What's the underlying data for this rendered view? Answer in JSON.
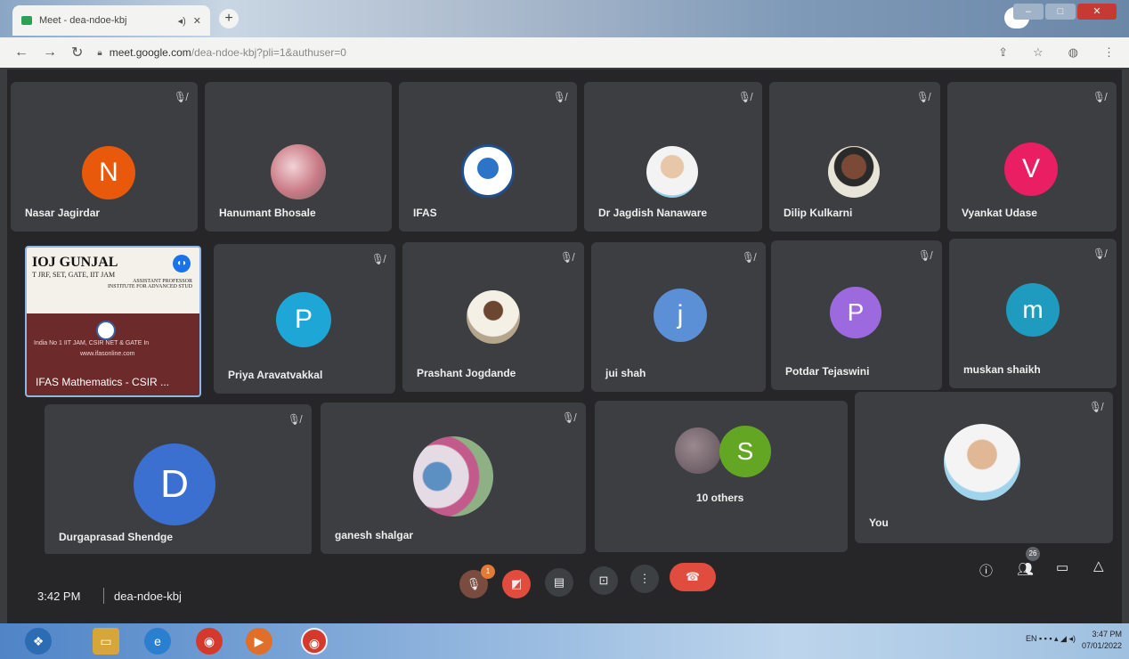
{
  "browser": {
    "tab_title": "Meet - dea-ndoe-kbj",
    "new_tab": "+",
    "url_host": "meet.google.com",
    "url_path": "/dea-ndoe-kbj?pli=1&authuser=0"
  },
  "meeting": {
    "time": "3:42 PM",
    "code": "dea-ndoe-kbj",
    "participant_count": "26",
    "raised_hands": "1"
  },
  "tiles": [
    {
      "name": "Nasar Jagirdar",
      "initial": "N",
      "color": "#e8590c"
    },
    {
      "name": "Hanumant Bhosale",
      "initial": "",
      "color": "#d9a0a5"
    },
    {
      "name": "IFAS",
      "initial": "",
      "color": "#ffffff"
    },
    {
      "name": "Dr Jagdish Nanaware",
      "initial": "",
      "color": "#9ad3e6"
    },
    {
      "name": "Dilip Kulkarni",
      "initial": "",
      "color": "#e6e1d5"
    },
    {
      "name": "Vyankat Udase",
      "initial": "V",
      "color": "#e91e63"
    },
    {
      "name": "Priya Aravatvakkal",
      "initial": "P",
      "color": "#1ea7d6"
    },
    {
      "name": "Prashant Jogdande",
      "initial": "",
      "color": "#c7b89c"
    },
    {
      "name": "jui shah",
      "initial": "j",
      "color": "#5b8fd6"
    },
    {
      "name": "Potdar Tejaswini",
      "initial": "P",
      "color": "#9c6ade"
    },
    {
      "name": "muskan shaikh",
      "initial": "m",
      "color": "#1f9bbf"
    },
    {
      "name": "Durgaprasad Shendge",
      "initial": "D",
      "color": "#3b6fd0"
    },
    {
      "name": "ganesh shalgar",
      "initial": "",
      "color": "#c8b3c7"
    },
    {
      "name": "10 others",
      "initial": "S",
      "color": "#62a624"
    },
    {
      "name": "You",
      "initial": "",
      "color": "#a7d9ee"
    }
  ],
  "presentation": {
    "heading": "IOJ GUNJAL",
    "subheading": "T JRF, SET, GATE, IIT JAM",
    "role": "ASSISTANT PROFESSOR",
    "institute": "INSTITUTE FOR ADVANCED STUD",
    "band_line1": "India No 1 IIT JAM, CSIR NET & GATE In",
    "band_line2": "www.ifasonline.com",
    "caption": "IFAS Mathematics - CSIR ..."
  },
  "taskbar": {
    "lang": "EN",
    "clock_time": "3:47 PM",
    "clock_date": "07/01/2022"
  }
}
